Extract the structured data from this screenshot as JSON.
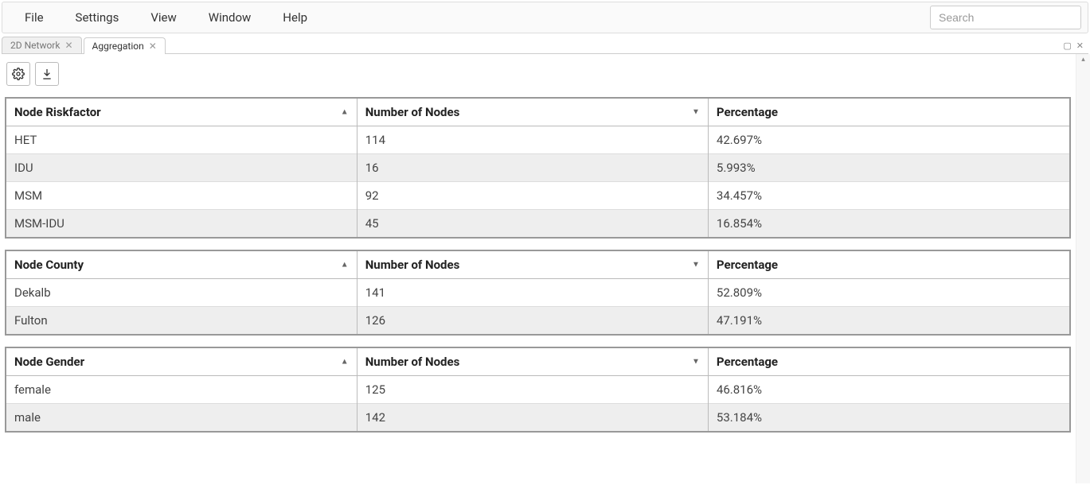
{
  "menubar": {
    "items": [
      "File",
      "Settings",
      "View",
      "Window",
      "Help"
    ],
    "search_placeholder": "Search"
  },
  "tabs": [
    {
      "label": "2D Network",
      "active": false
    },
    {
      "label": "Aggregation",
      "active": true
    }
  ],
  "toolbar": {
    "settings_icon": "gear-icon",
    "download_icon": "download-icon"
  },
  "tables": [
    {
      "group_header": "Node Riskfactor",
      "count_header": "Number of Nodes",
      "pct_header": "Percentage",
      "group_sort": "asc",
      "count_sort": "desc",
      "rows": [
        {
          "group": "HET",
          "count": "114",
          "pct": "42.697%"
        },
        {
          "group": "IDU",
          "count": "16",
          "pct": "5.993%"
        },
        {
          "group": "MSM",
          "count": "92",
          "pct": "34.457%"
        },
        {
          "group": "MSM-IDU",
          "count": "45",
          "pct": "16.854%"
        }
      ]
    },
    {
      "group_header": "Node County",
      "count_header": "Number of Nodes",
      "pct_header": "Percentage",
      "group_sort": "asc",
      "count_sort": "desc",
      "rows": [
        {
          "group": "Dekalb",
          "count": "141",
          "pct": "52.809%"
        },
        {
          "group": "Fulton",
          "count": "126",
          "pct": "47.191%"
        }
      ]
    },
    {
      "group_header": "Node Gender",
      "count_header": "Number of Nodes",
      "pct_header": "Percentage",
      "group_sort": "asc",
      "count_sort": "desc",
      "rows": [
        {
          "group": "female",
          "count": "125",
          "pct": "46.816%"
        },
        {
          "group": "male",
          "count": "142",
          "pct": "53.184%"
        }
      ]
    }
  ]
}
